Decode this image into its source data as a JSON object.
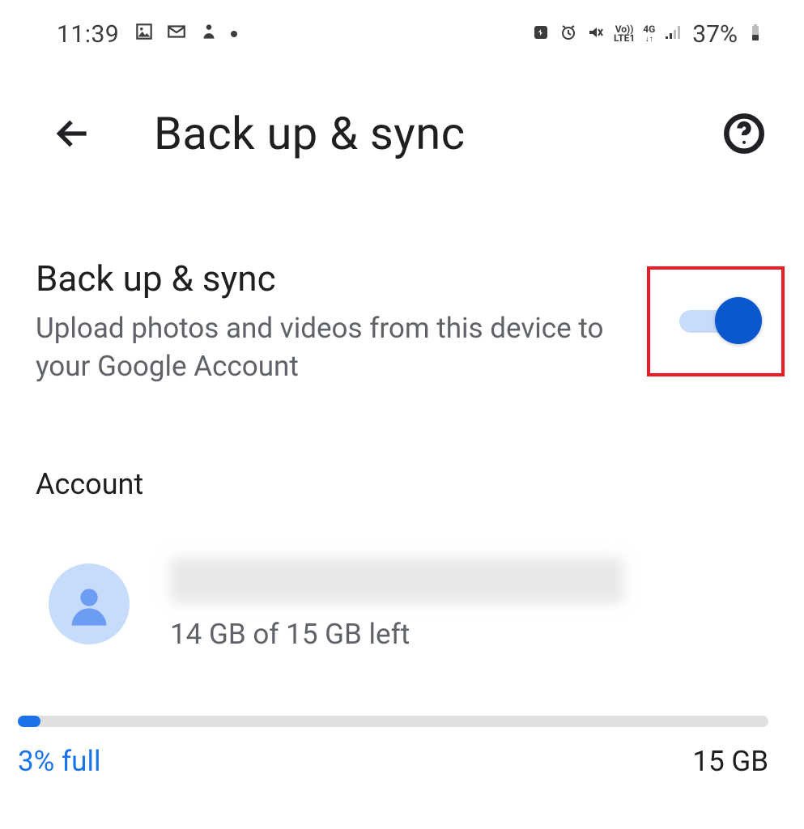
{
  "status": {
    "time": "11:39",
    "lte_label_top": "Vo))",
    "lte_label_bottom": "LTE1",
    "net_label": "4G",
    "battery_text": "37%"
  },
  "header": {
    "title": "Back up & sync"
  },
  "backup_toggle": {
    "title": "Back up & sync",
    "subtitle": "Upload photos and videos from this device to your Google Account",
    "enabled": true
  },
  "account": {
    "section_label": "Account",
    "storage_left": "14 GB of 15 GB left"
  },
  "storage": {
    "percent_full_label": "3% full",
    "total_label": "15 GB",
    "percent_fill": 3
  }
}
